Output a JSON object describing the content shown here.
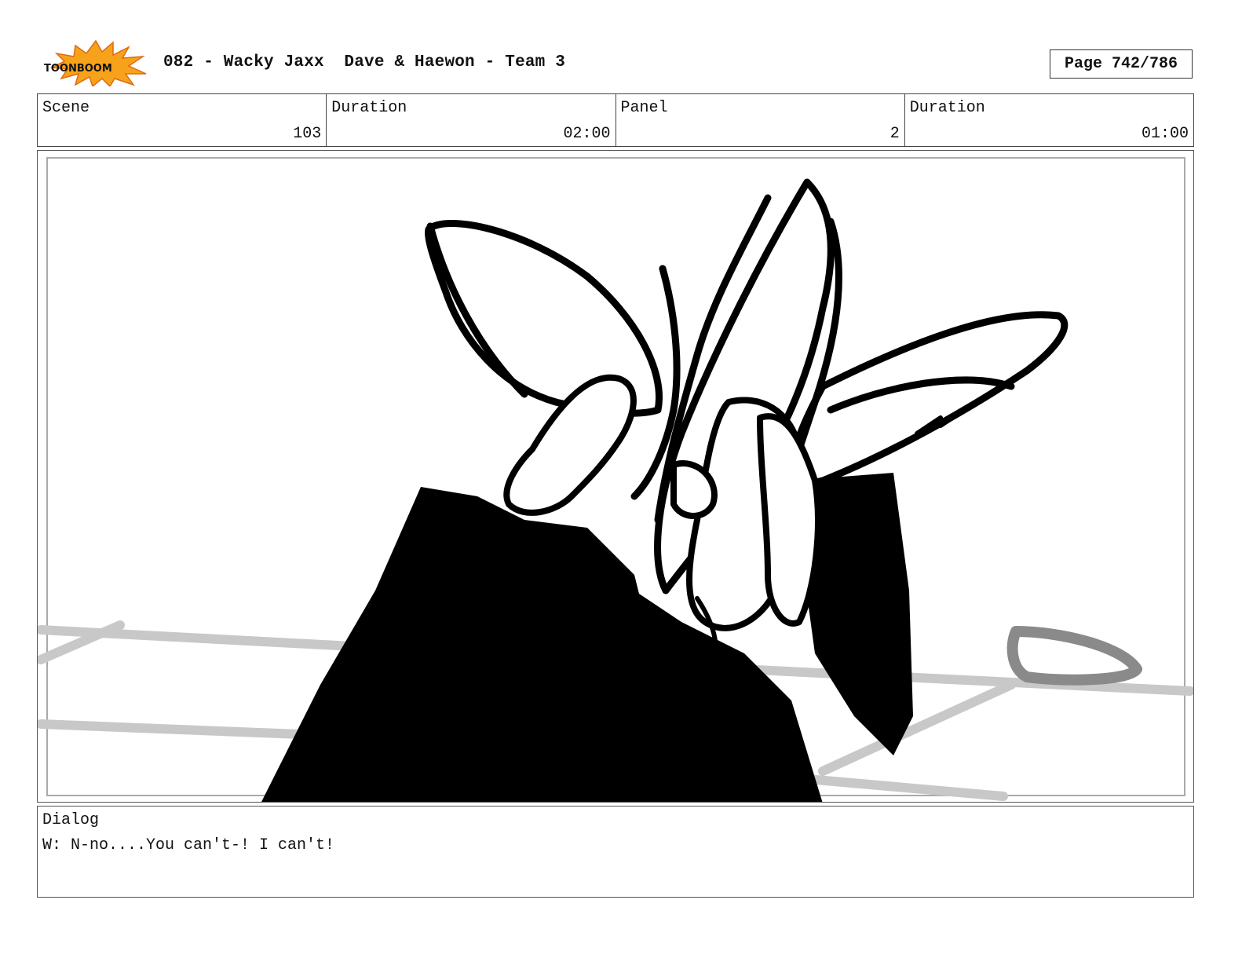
{
  "header": {
    "logo_text": "TOONBOOM",
    "title": "082 - Wacky Jaxx  Dave & Haewon - Team 3",
    "page_label": "Page 742/786"
  },
  "info": {
    "scene_label": "Scene",
    "scene_value": "103",
    "scene_duration_label": "Duration",
    "scene_duration_value": "02:00",
    "panel_label": "Panel",
    "panel_value": "2",
    "panel_duration_label": "Duration",
    "panel_duration_value": "01:00"
  },
  "dialog": {
    "label": "Dialog",
    "text": "W: N-no....You can't-! I can't!"
  }
}
